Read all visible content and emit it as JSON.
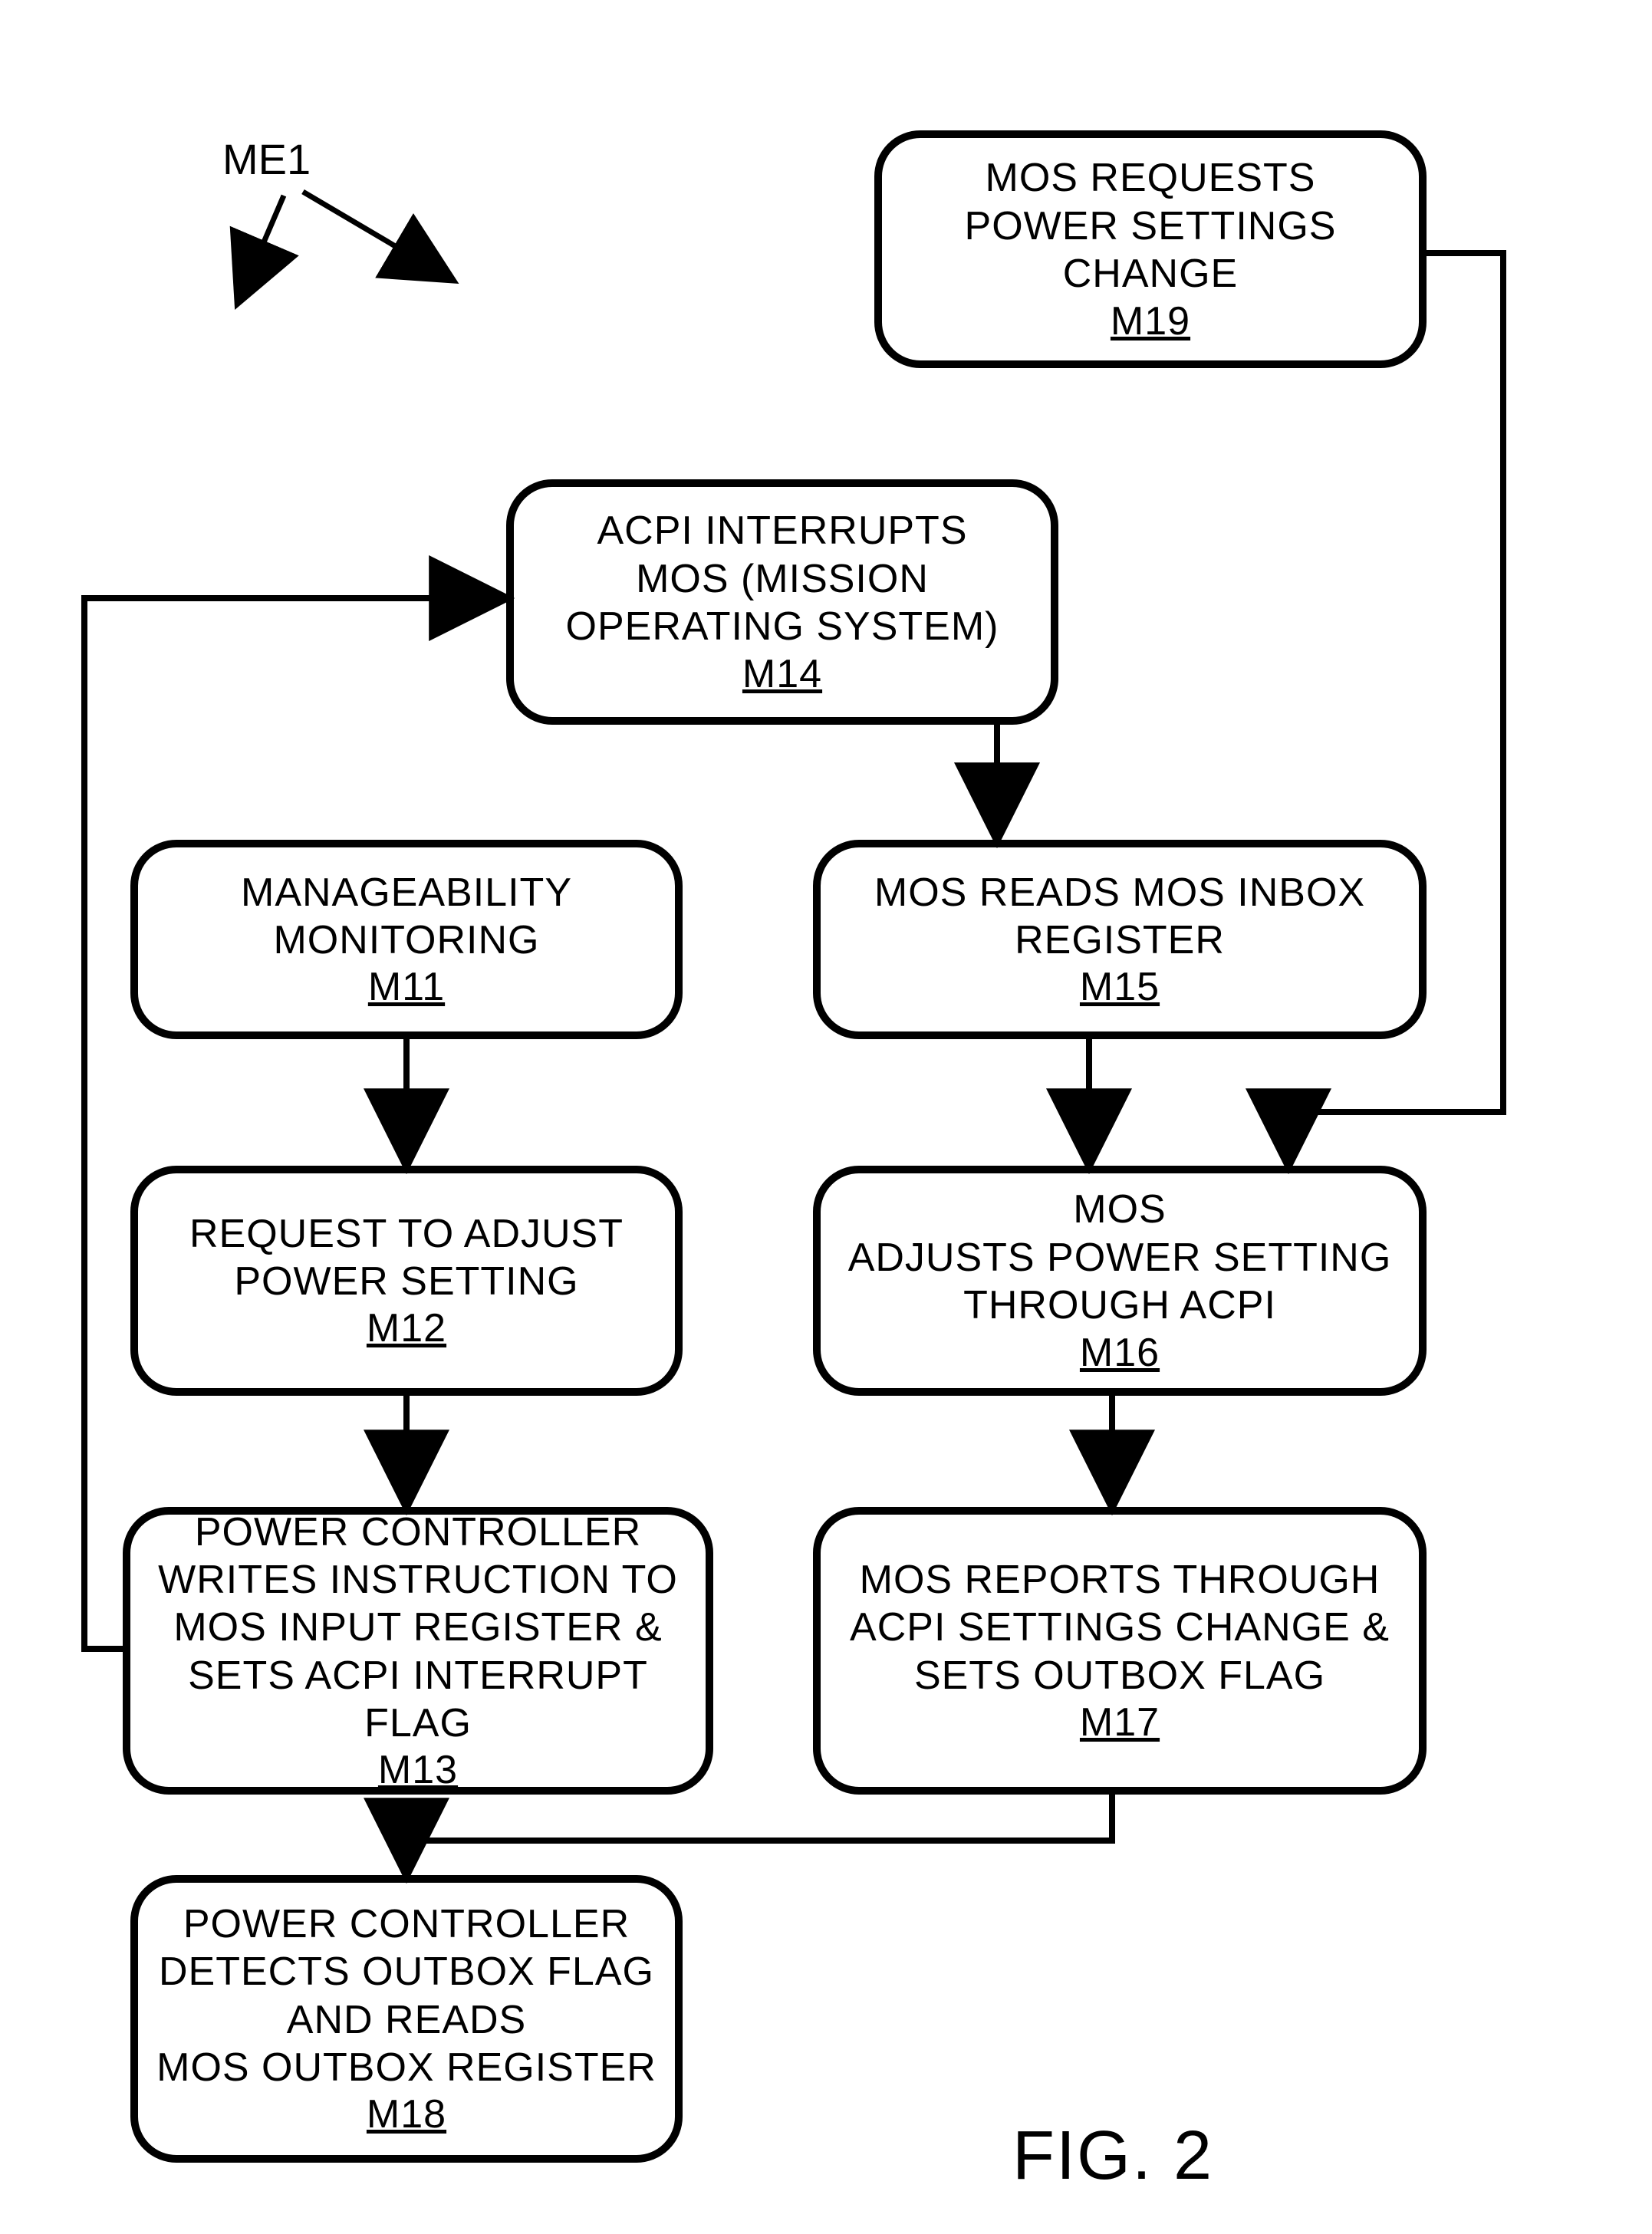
{
  "label_me1": "ME1",
  "figure_label": "FIG. 2",
  "nodes": {
    "m19": {
      "text": "MOS REQUESTS\nPOWER SETTINGS\nCHANGE",
      "id": "M19"
    },
    "m14": {
      "text": "ACPI INTERRUPTS\nMOS (MISSION\nOPERATING SYSTEM)",
      "id": "M14"
    },
    "m11": {
      "text": "MANAGEABILITY\nMONITORING",
      "id": "M11"
    },
    "m15": {
      "text": "MOS READS MOS INBOX\nREGISTER",
      "id": "M15"
    },
    "m12": {
      "text": "REQUEST TO ADJUST\nPOWER SETTING",
      "id": "M12"
    },
    "m16": {
      "text": "MOS\nADJUSTS POWER SETTING\nTHROUGH ACPI",
      "id": "M16"
    },
    "m13": {
      "text": "POWER CONTROLLER\nWRITES INSTRUCTION TO\nMOS INPUT REGISTER  &\nSETS ACPI INTERRUPT FLAG",
      "id": "M13"
    },
    "m17": {
      "text": "MOS  REPORTS THROUGH\nACPI SETTINGS CHANGE &\nSETS  OUTBOX FLAG",
      "id": "M17"
    },
    "m18": {
      "text": "POWER CONTROLLER\nDETECTS OUTBOX FLAG\nAND READS\nMOS OUTBOX REGISTER",
      "id": "M18"
    }
  }
}
